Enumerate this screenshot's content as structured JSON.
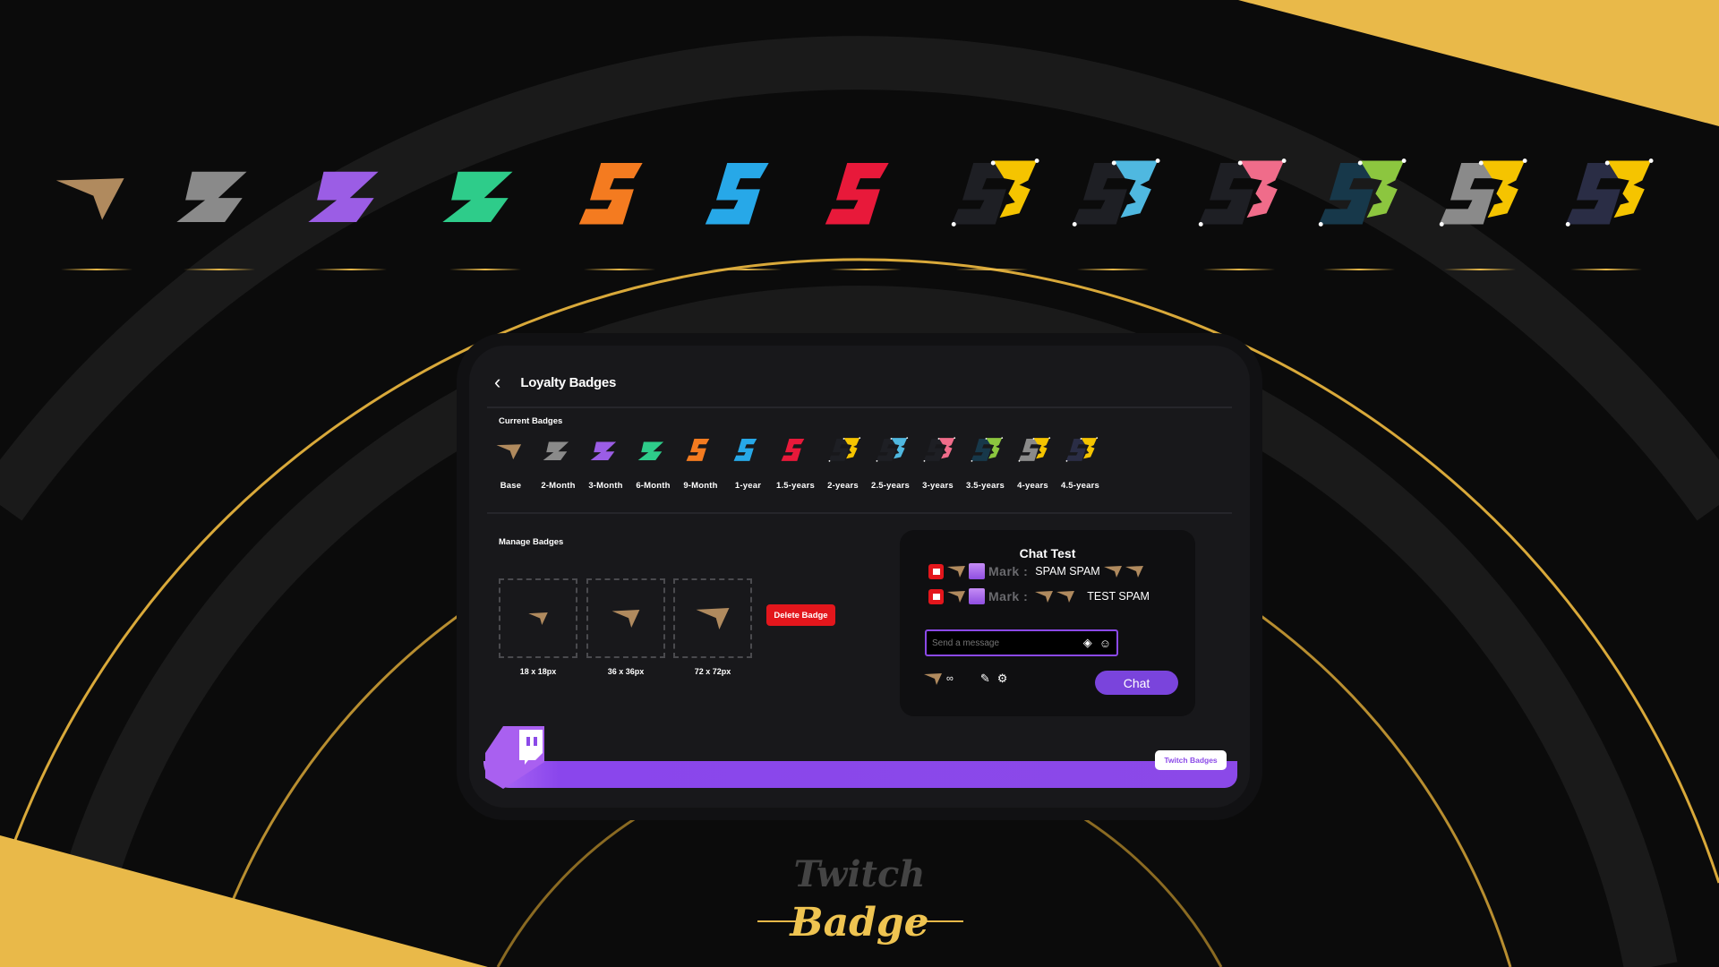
{
  "colors": {
    "gold": "#e9b949",
    "purple": "#8b49e8",
    "panel": "#18181b",
    "red": "#e3161c"
  },
  "badges": [
    {
      "label": "Base",
      "shape": "chevron",
      "color": "#b08a5e"
    },
    {
      "label": "2-Month",
      "shape": "z",
      "color": "#8a8a8a"
    },
    {
      "label": "3-Month",
      "shape": "z",
      "color": "#9b5de5"
    },
    {
      "label": "6-Month",
      "shape": "z",
      "color": "#2ecc8a"
    },
    {
      "label": "9-Month",
      "shape": "s",
      "color": "#f47b20"
    },
    {
      "label": "1-year",
      "shape": "s",
      "color": "#27a8e8"
    },
    {
      "label": "1.5-years",
      "shape": "s",
      "color": "#e8193a"
    },
    {
      "label": "2-years",
      "shape": "s3",
      "color": "#f5c400",
      "back": "#1e1f24"
    },
    {
      "label": "2.5-years",
      "shape": "s3",
      "color": "#4fb8e0",
      "back": "#1e1f24"
    },
    {
      "label": "3-years",
      "shape": "s3",
      "color": "#f06c8a",
      "back": "#1e1f24"
    },
    {
      "label": "3.5-years",
      "shape": "s3",
      "color": "#8cc63f",
      "back": "#17384a"
    },
    {
      "label": "4-years",
      "shape": "s3",
      "color": "#f5c400",
      "back": "#8a8a8a"
    },
    {
      "label": "4.5-years",
      "shape": "s3",
      "color": "#f5c400",
      "back": "#2a2d45"
    }
  ],
  "panel": {
    "title": "Loyalty Badges",
    "current_heading": "Current Badges",
    "manage_heading": "Manage Badges",
    "sizes": [
      "18 x 18px",
      "36 x 36px",
      "72 x 72px"
    ],
    "delete_label": "Delete Badge",
    "tag": "Twitch Badges"
  },
  "chat": {
    "title": "Chat Test",
    "messages": [
      {
        "user": "Mark :",
        "text": "SPAM SPAM"
      },
      {
        "user": "Mark :",
        "text": "TEST SPAM"
      }
    ],
    "placeholder": "Send a message",
    "infinity": "∞",
    "button": "Chat"
  },
  "logo": {
    "line1": "Twitch",
    "line2": "Badge"
  }
}
